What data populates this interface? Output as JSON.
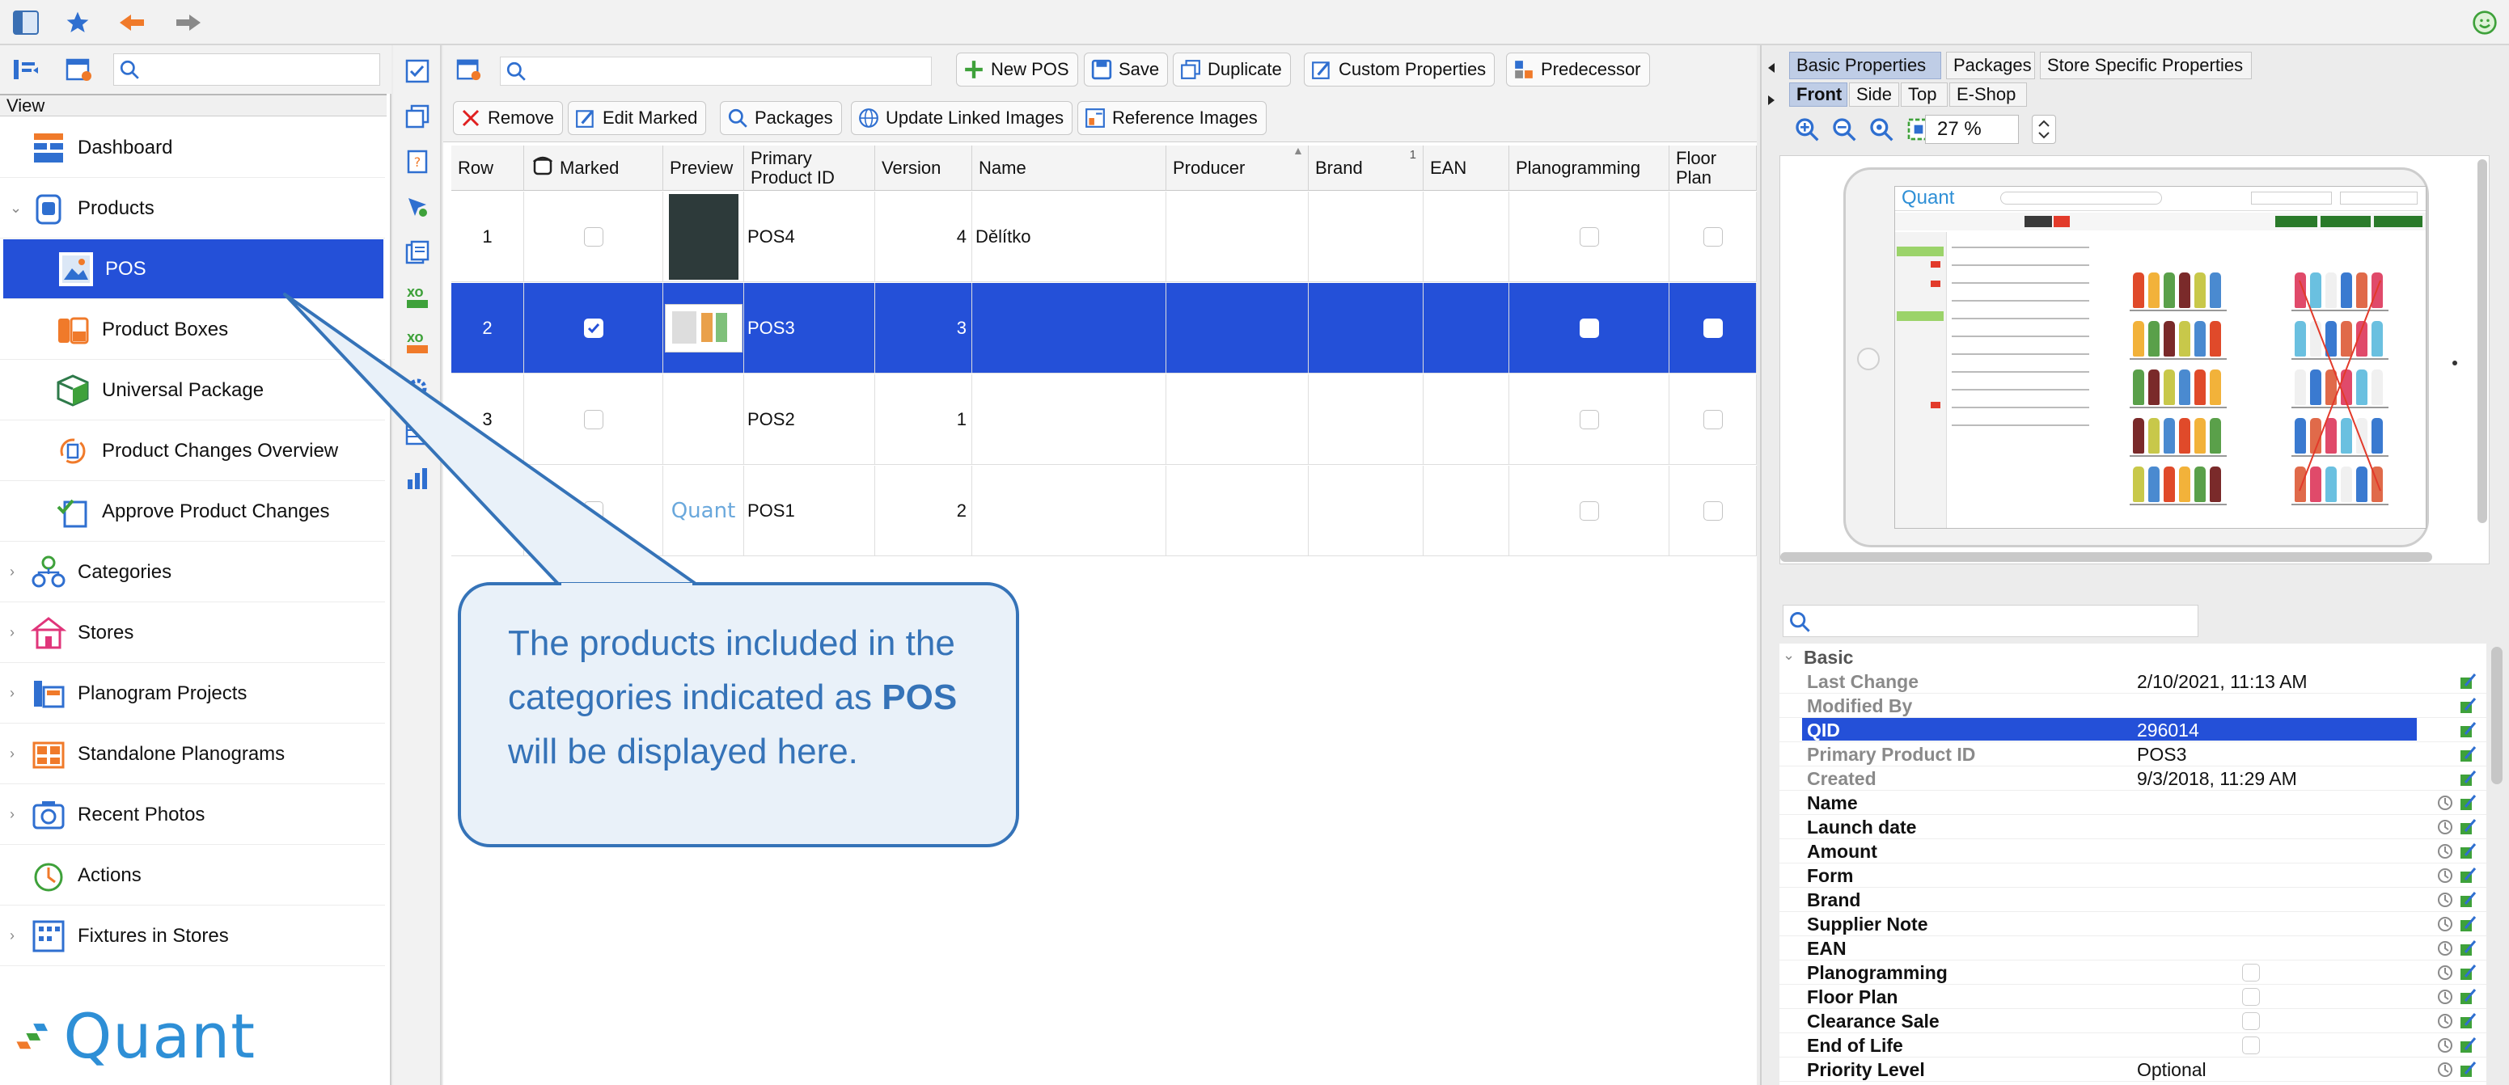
{
  "topbar": {
    "icons": [
      "sidebar-toggle-icon",
      "star-icon",
      "back-arrow-icon",
      "forward-arrow-icon",
      "smiley-icon"
    ]
  },
  "sidebar": {
    "view_label": "View",
    "items": [
      {
        "label": "Dashboard",
        "icon": "dashboard-icon",
        "level": 0,
        "expandable": false
      },
      {
        "label": "Products",
        "icon": "products-icon",
        "level": 0,
        "expandable": true,
        "expanded": true
      },
      {
        "label": "POS",
        "icon": "pos-image-icon",
        "level": 1,
        "selected": true
      },
      {
        "label": "Product Boxes",
        "icon": "product-boxes-icon",
        "level": 1
      },
      {
        "label": "Universal Package",
        "icon": "package-icon",
        "level": 1
      },
      {
        "label": "Product Changes Overview",
        "icon": "changes-icon",
        "level": 1
      },
      {
        "label": "Approve Product Changes",
        "icon": "approve-icon",
        "level": 1
      },
      {
        "label": "Categories",
        "icon": "categories-icon",
        "level": 0,
        "expandable": true
      },
      {
        "label": "Stores",
        "icon": "stores-icon",
        "level": 0,
        "expandable": true
      },
      {
        "label": "Planogram Projects",
        "icon": "planogram-projects-icon",
        "level": 0,
        "expandable": true
      },
      {
        "label": "Standalone Planograms",
        "icon": "standalone-planograms-icon",
        "level": 0,
        "expandable": true
      },
      {
        "label": "Recent Photos",
        "icon": "camera-icon",
        "level": 0,
        "expandable": true
      },
      {
        "label": "Actions",
        "icon": "actions-icon",
        "level": 0,
        "expandable": false
      },
      {
        "label": "Fixtures in Stores",
        "icon": "fixtures-icon",
        "level": 0,
        "expandable": true
      }
    ],
    "logo_text": "Quant"
  },
  "toolbar": {
    "new_pos": "New POS",
    "save": "Save",
    "duplicate": "Duplicate",
    "custom_properties": "Custom Properties",
    "predecessor": "Predecessor",
    "remove": "Remove",
    "edit_marked": "Edit Marked",
    "packages": "Packages",
    "update_linked_images": "Update Linked Images",
    "reference_images": "Reference Images"
  },
  "grid": {
    "columns": [
      "Row",
      "Marked",
      "Preview",
      "Primary Product ID",
      "Version",
      "Name",
      "Producer",
      "Brand",
      "EAN",
      "Planogramming",
      "Floor Plan"
    ],
    "brand_sort_index": "1",
    "rows": [
      {
        "row": "1",
        "marked": false,
        "preview": "dark-thumbnail",
        "primary_id": "POS4",
        "version": "4",
        "name": "Dělítko",
        "planogramming": false,
        "floor_plan": false,
        "selected": false
      },
      {
        "row": "2",
        "marked": true,
        "preview": "screenshot-thumbnail",
        "primary_id": "POS3",
        "version": "3",
        "name": "",
        "planogramming": false,
        "floor_plan": false,
        "selected": true
      },
      {
        "row": "3",
        "marked": false,
        "preview": "",
        "primary_id": "POS2",
        "version": "1",
        "name": "",
        "planogramming": false,
        "floor_plan": false,
        "selected": false
      },
      {
        "row": "",
        "marked": false,
        "preview": "quant-logo-thumbnail",
        "preview_text": "Quant",
        "primary_id": "POS1",
        "version": "2",
        "name": "",
        "planogramming": false,
        "floor_plan": false,
        "selected": false
      }
    ]
  },
  "callout": {
    "text_before": "The products included in the categories indicated as ",
    "text_bold": "POS",
    "text_after": " will be displayed here."
  },
  "right_panel": {
    "tabs": [
      "Basic Properties",
      "Packages",
      "Store Specific Properties"
    ],
    "active_tab": "Basic Properties",
    "view_tabs": [
      "Front",
      "Side",
      "Top",
      "E-Shop"
    ],
    "active_view_tab": "Front",
    "zoom": "27 %",
    "preview_logo": "Quant",
    "properties_group": "Basic",
    "properties": [
      {
        "key": "Last Change",
        "value": "2/10/2021, 11:13 AM",
        "readonly": true
      },
      {
        "key": "Modified By",
        "value": "",
        "readonly": true
      },
      {
        "key": "QID",
        "value": "296014",
        "readonly": true,
        "selected": true
      },
      {
        "key": "Primary Product ID",
        "value": "POS3",
        "readonly": true
      },
      {
        "key": "Created",
        "value": "9/3/2018, 11:29 AM",
        "readonly": true
      },
      {
        "key": "Name",
        "value": ""
      },
      {
        "key": "Launch date",
        "value": ""
      },
      {
        "key": "Amount",
        "value": ""
      },
      {
        "key": "Form",
        "value": ""
      },
      {
        "key": "Brand",
        "value": ""
      },
      {
        "key": "Supplier Note",
        "value": ""
      },
      {
        "key": "EAN",
        "value": ""
      },
      {
        "key": "Planogramming",
        "value": "",
        "checkbox": true
      },
      {
        "key": "Floor Plan",
        "value": "",
        "checkbox": true
      },
      {
        "key": "Clearance Sale",
        "value": "",
        "checkbox": true
      },
      {
        "key": "End of Life",
        "value": "",
        "checkbox": true
      },
      {
        "key": "Priority Level",
        "value": "Optional"
      }
    ]
  },
  "colors": {
    "selection": "#2450d8",
    "accent": "#3573b8",
    "callout_fill": "#e9f1f9"
  }
}
